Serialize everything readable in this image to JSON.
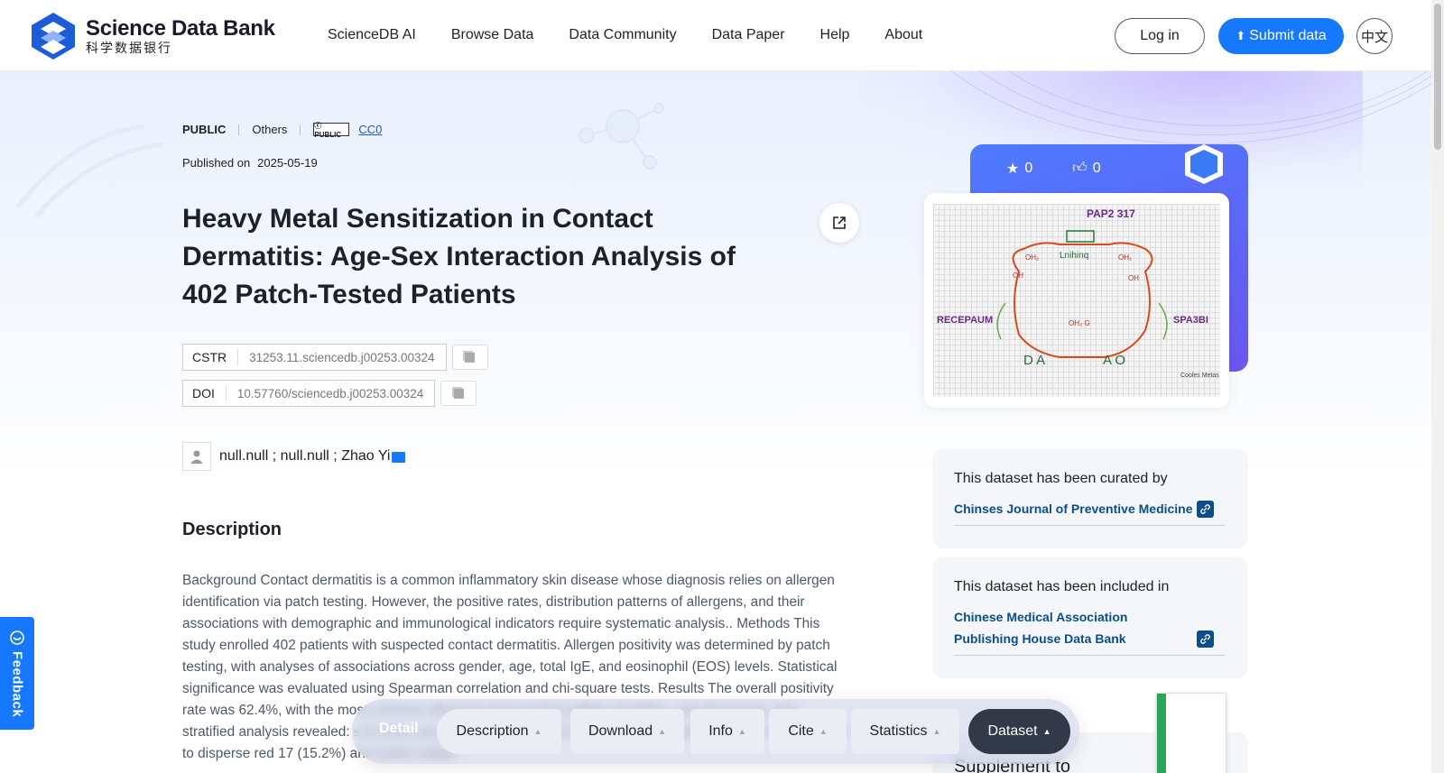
{
  "header": {
    "logo_en": "Science Data Bank",
    "logo_cn": "科学数据银行",
    "nav": [
      "ScienceDB AI",
      "Browse Data",
      "Data Community",
      "Data Paper",
      "Help",
      "About"
    ],
    "login_label": "Log in",
    "submit_label": "Submit data",
    "lang_label": "中文",
    "brand_color": "#1677ff"
  },
  "meta": {
    "access": "PUBLIC",
    "category": "Others",
    "license": "CC0",
    "published_label": "Published on",
    "published_date": "2025-05-19"
  },
  "title": "Heavy Metal Sensitization in Contact Dermatitis: Age-Sex Interaction Analysis of 402 Patch-Tested Patients",
  "identifiers": {
    "cstr_label": "CSTR",
    "cstr_value": "31253.11.sciencedb.j00253.00324",
    "doi_label": "DOI",
    "doi_value": "10.57760/sciencedb.j00253.00324"
  },
  "authors": "null.null ; null.null ; Zhao Yi",
  "description": {
    "heading": "Description",
    "text": "Background Contact dermatitis is a common inflammatory skin disease whose diagnosis relies on allergen identification via patch testing. However, the positive rates, distribution patterns of allergens, and their associations with demographic and immunological indicators require systematic analysis.. Methods This study enrolled 402 patients with suspected contact dermatitis. Allergen positivity was determined by patch testing, with analyses of associations across gender, age, total IgE, and eosinophil (EOS) levels. Statistical significance was evaluated using Spearman correlation and chi-square tests. Results The overall positivity rate was 62.4%, with the most common allergens being nickel sulfate (19.90%), and thimerosal. Age-stratified analysis revealed: ≤18 years group: low positivity: 18.2%); 19-35 years group: Notable sensitization to disperse red 17 (15.2%) and nickel sulfate"
  },
  "stats": {
    "stars": "0",
    "likes": "0"
  },
  "cover": {
    "labels": [
      "PAP2 317",
      "Lnihinq",
      "RECEPAUM",
      "SPA3BI",
      "D A",
      "A O",
      "OH₂",
      "OH₃ G",
      "OH",
      "OH₂",
      "OH"
    ],
    "corner_note": "Cooles Metas"
  },
  "curated": {
    "heading": "This dataset has been curated by",
    "link": "Chinses Journal of Preventive Medicine"
  },
  "included": {
    "heading": "This dataset has been included in",
    "link": "Chinese Medical Association Publishing House Data Bank"
  },
  "supplement": {
    "heading": "Supplement to"
  },
  "feedback_label": "Feedback",
  "tabbar": {
    "detail_label": "Detail",
    "tabs": [
      "Description",
      "Download",
      "Info",
      "Cite",
      "Statistics",
      "Dataset"
    ],
    "active": "Dataset"
  }
}
